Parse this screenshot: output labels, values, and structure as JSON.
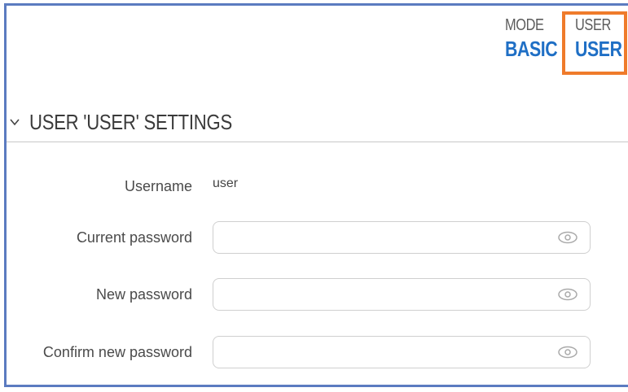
{
  "header": {
    "mode_label": "MODE",
    "mode_value": "BASIC",
    "user_label": "USER",
    "user_value": "USER"
  },
  "section": {
    "title": "USER 'USER' SETTINGS",
    "collapse_icon": "chevron-down-icon"
  },
  "form": {
    "username_label": "Username",
    "username_value": "user",
    "current_password_label": "Current password",
    "new_password_label": "New password",
    "confirm_password_label": "Confirm new password",
    "eye_icon": "eye-icon"
  },
  "colors": {
    "accent_blue": "#1f6fc5",
    "highlight_orange": "#ef7b2b",
    "frame_blue": "#5b7bc0"
  }
}
